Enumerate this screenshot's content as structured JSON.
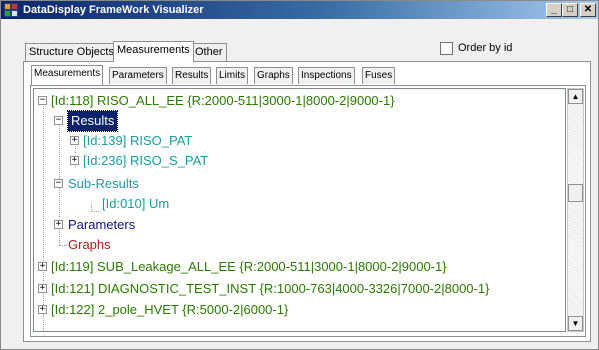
{
  "window": {
    "title": "DataDisplay FrameWork Visualizer",
    "minimize": "_",
    "maximize": "□",
    "close": "✕"
  },
  "outer_tabs": [
    "Structure Objects",
    "Measurements",
    "Other"
  ],
  "order_by": {
    "label": "Order by id",
    "checked": false
  },
  "inner_tabs": [
    "Measurements",
    "Parameters",
    "Results",
    "Limits",
    "Graphs",
    "Inspections",
    "Fuses"
  ],
  "tree": [
    {
      "label": "[Id:118] RISO_ALL_EE {R:2000-511|3000-1|8000-2|9000-1}",
      "color": "#2b7a00",
      "expander": "−"
    },
    {
      "label": "Results",
      "color": "#ffffff",
      "expander": "−",
      "selected": true
    },
    {
      "label": "[Id:139] RISO_PAT",
      "color": "#1a9ba0",
      "expander": "+"
    },
    {
      "label": "[Id:236] RISO_S_PAT",
      "color": "#1a9ba0",
      "expander": "+"
    },
    {
      "label": "Sub-Results",
      "color": "#1a9ba0",
      "expander": "−"
    },
    {
      "label": "[Id:010] Um",
      "color": "#1a9ba0"
    },
    {
      "label": "Parameters",
      "color": "#14147a",
      "expander": "+"
    },
    {
      "label": "Graphs",
      "color": "#a81f1f"
    },
    {
      "label": "[Id:119] SUB_Leakage_ALL_EE {R:2000-511|3000-1|8000-2|9000-1}",
      "color": "#2b7a00",
      "expander": "+"
    },
    {
      "label": "[Id:121] DIAGNOSTIC_TEST_INST {R:1000-763|4000-3326|7000-2|8000-1}",
      "color": "#2b7a00",
      "expander": "+"
    },
    {
      "label": "[Id:122] 2_pole_HVET {R:5000-2|6000-1}",
      "color": "#2b7a00",
      "expander": "+"
    }
  ],
  "scrollbar": {
    "up": "▲",
    "down": "▼"
  }
}
